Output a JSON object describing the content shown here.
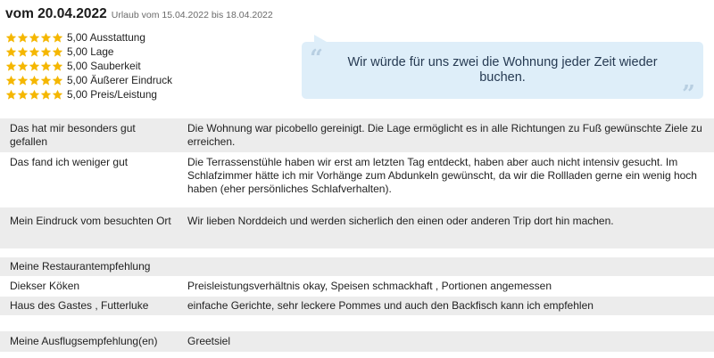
{
  "review": {
    "date": "vom 20.04.2022",
    "period": "Urlaub vom 15.04.2022 bis 18.04.2022"
  },
  "ratings": [
    {
      "stars": 5,
      "text": "5,00 Ausstattung"
    },
    {
      "stars": 5,
      "text": "5,00 Lage"
    },
    {
      "stars": 5,
      "text": "5,00 Sauberkeit"
    },
    {
      "stars": 5,
      "text": "5,00 Äußerer Eindruck"
    },
    {
      "stars": 5,
      "text": "5,00 Preis/Leistung"
    }
  ],
  "quote": {
    "open": "“",
    "close": "”",
    "text": "Wir würde für uns zwei die Wohnung jeder Zeit wieder buchen."
  },
  "details": {
    "liked": {
      "label": "Das hat mir besonders gut gefallen",
      "value": "Die Wohnung war picobello gereinigt. Die Lage ermöglicht es in alle Richtungen zu Fuß gewünschte Ziele zu erreichen."
    },
    "disliked": {
      "label": "Das fand ich weniger gut",
      "value": "Die Terrassenstühle haben wir erst am letzten Tag entdeckt, haben aber auch nicht intensiv gesucht. Im Schlafzimmer hätte ich mir Vorhänge zum Abdunkeln gewünscht, da wir die Rollladen gerne ein wenig hoch haben (eher persönliches Schlafverhalten)."
    },
    "impression": {
      "label": "Mein Eindruck vom besuchten Ort",
      "value": "Wir lieben Norddeich und werden sicherlich den einen oder anderen Trip dort hin machen."
    },
    "restaurants": {
      "heading": "Meine Restaurantempfehlung",
      "items": [
        {
          "name": "Diekser Köken",
          "comment": "Preisleistungsverhältnis okay, Speisen schmackhaft , Portionen angemessen"
        },
        {
          "name": "Haus des Gastes , Futterluke",
          "comment": "einfache Gerichte, sehr leckere Pommes und auch den Backfisch kann ich empfehlen"
        }
      ]
    },
    "excursion": {
      "label": "Meine Ausflugsempfehlung(en)",
      "value": "Greetsiel"
    }
  },
  "colors": {
    "star": "#f5b700",
    "quote_bg": "#deeef9",
    "row_shade": "#ececec"
  }
}
